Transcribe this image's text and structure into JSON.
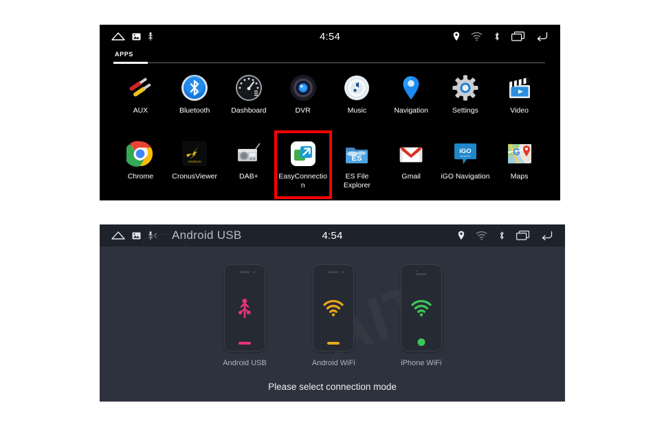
{
  "panel_apps": {
    "status_bar": {
      "time": "4:54",
      "left_icons": [
        "home-icon",
        "gallery-icon",
        "usb-icon"
      ],
      "right_icons": [
        "location-icon",
        "wifi-icon",
        "bluetooth-icon",
        "recents-icon",
        "back-icon"
      ]
    },
    "tab": {
      "label": "APPS"
    },
    "apps": [
      {
        "name": "AUX",
        "icon": "aux-icon"
      },
      {
        "name": "Bluetooth",
        "icon": "bluetooth-app-icon"
      },
      {
        "name": "Dashboard",
        "icon": "dashboard-icon"
      },
      {
        "name": "DVR",
        "icon": "dvr-icon"
      },
      {
        "name": "Music",
        "icon": "music-icon"
      },
      {
        "name": "Navigation",
        "icon": "navigation-icon"
      },
      {
        "name": "Settings",
        "icon": "settings-icon"
      },
      {
        "name": "Video",
        "icon": "video-icon"
      },
      {
        "name": "Chrome",
        "icon": "chrome-icon"
      },
      {
        "name": "CronusViewer",
        "icon": "cronusviewer-icon"
      },
      {
        "name": "DAB+",
        "icon": "dab-radio-icon"
      },
      {
        "name": "EasyConnection",
        "icon": "easyconnection-icon"
      },
      {
        "name": "ES File Explorer",
        "icon": "es-file-explorer-icon"
      },
      {
        "name": "Gmail",
        "icon": "gmail-icon"
      },
      {
        "name": "iGO Navigation",
        "icon": "igo-navigation-icon"
      },
      {
        "name": "Maps",
        "icon": "maps-icon"
      }
    ],
    "highlight": {
      "target": "EasyConnection",
      "color": "#ff0000"
    }
  },
  "panel_easyconnection": {
    "status_bar": {
      "time": "4:54",
      "left_icons": [
        "home-icon",
        "gallery-icon",
        "usb-icon"
      ],
      "right_icons": [
        "location-icon",
        "wifi-icon",
        "bluetooth-icon",
        "recents-icon",
        "back-icon"
      ]
    },
    "title": "Android USB",
    "back_chevron": "‹",
    "cards": [
      {
        "label": "Android USB",
        "icon": "usb-connect-icon",
        "color": "#e8317e",
        "device": "android"
      },
      {
        "label": "Android WiFi",
        "icon": "wifi-connect-icon",
        "color": "#e8a51c",
        "device": "android"
      },
      {
        "label": "iPhone WiFi",
        "icon": "wifi-connect-icon",
        "color": "#3ec659",
        "device": "iphone"
      }
    ],
    "hint": "Please select connection mode",
    "watermark": "AIT"
  }
}
